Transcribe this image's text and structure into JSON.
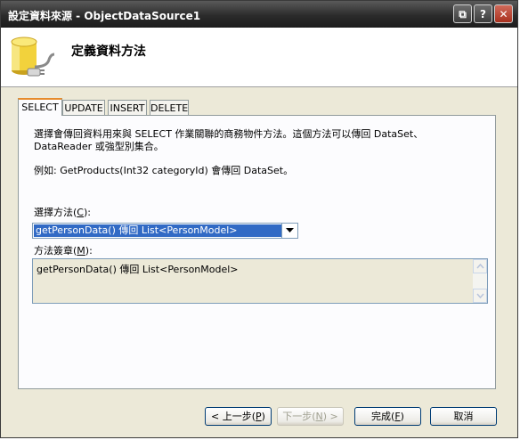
{
  "window": {
    "title": "設定資料來源 - ObjectDataSource1",
    "controls": {
      "restore_glyph": "⧉",
      "help_glyph": "?",
      "close_glyph": "✕"
    }
  },
  "header": {
    "title": "定義資料方法",
    "icon": "database-plug-icon"
  },
  "tabs": [
    {
      "label": "SELECT",
      "active": true
    },
    {
      "label": "UPDATE",
      "active": false
    },
    {
      "label": "INSERT",
      "active": false
    },
    {
      "label": "DELETE",
      "active": false
    }
  ],
  "panel": {
    "description_line1": "選擇會傳回資料用來與 SELECT 作業關聯的商務物件方法。這個方法可以傳回 DataSet、",
    "description_line2": "DataReader 或強型別集合。",
    "example": "例如: GetProducts(Int32 categoryId) 會傳回 DataSet。",
    "method_label": "選擇方法(",
    "method_label_key": "C",
    "method_label_end": "):",
    "method_selected": "getPersonData() 傳回 List<PersonModel>",
    "signature_label": "方法簽章(",
    "signature_label_key": "M",
    "signature_label_end": "):",
    "signature_value": "getPersonData() 傳回 List<PersonModel>"
  },
  "buttons": {
    "back_pre": "< 上一步(",
    "back_key": "P",
    "back_post": ")",
    "next_pre": "下一步(",
    "next_key": "N",
    "next_post": ") >",
    "finish_pre": "完成(",
    "finish_key": "F",
    "finish_post": ")",
    "cancel": "取消"
  },
  "colors": {
    "selection": "#316ac5",
    "tab_accent": "#e68b2c"
  }
}
